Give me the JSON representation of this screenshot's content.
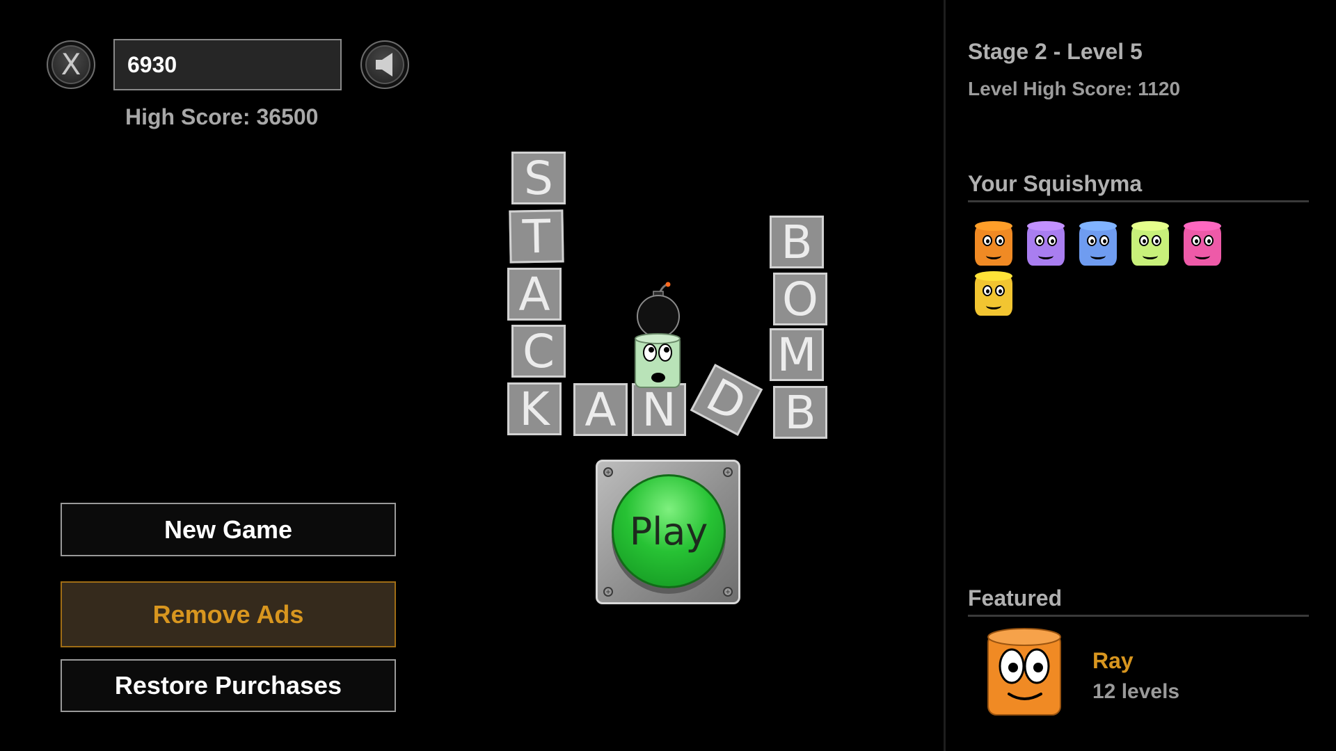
{
  "score": {
    "current": "6930",
    "high_score_text": "High Score: 36500"
  },
  "controls": {
    "close_icon": "close-icon",
    "sound_icon": "speaker-icon",
    "close_glyph": "X"
  },
  "menu": {
    "new_game": "New Game",
    "remove_ads": "Remove Ads",
    "restore_purchases": "Restore Purchases"
  },
  "logo": {
    "letters": [
      "S",
      "T",
      "A",
      "C",
      "K",
      "A",
      "N",
      "D",
      "B",
      "O",
      "M",
      "B"
    ]
  },
  "play_button": {
    "label": "Play"
  },
  "level_info": {
    "stage_level": "Stage 2 - Level 5",
    "level_high_score": "Level High Score: 1120"
  },
  "squishyma": {
    "title": "Your Squishyma",
    "colors": [
      "#f08a24",
      "#a97ef0",
      "#6f9cf0",
      "#c8f07a",
      "#ee5aa8",
      "#f2c531"
    ]
  },
  "featured": {
    "title": "Featured",
    "name": "Ray",
    "levels": "12 levels",
    "color": "#f08a24"
  },
  "colors": {
    "accent_orange": "#d8961f",
    "tile_gray": "#8f8f8f"
  }
}
